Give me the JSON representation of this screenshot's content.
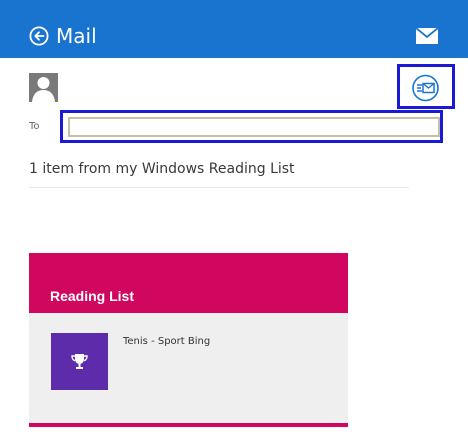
{
  "header": {
    "title": "Mail",
    "back_icon": "back-arrow-icon",
    "mail_icon": "envelope-icon",
    "bg_color": "#1874cf"
  },
  "compose": {
    "avatar_icon": "user-silhouette-icon",
    "send_icon": "send-mail-icon",
    "to_label": "To",
    "to_value": "",
    "subject": "1 item from my Windows Reading List"
  },
  "card": {
    "title": "Reading List",
    "item_label": "Tenis - Sport Bing",
    "tile_icon": "trophy-icon",
    "accent_color": "#d1065e",
    "tile_color": "#5c2cab"
  }
}
